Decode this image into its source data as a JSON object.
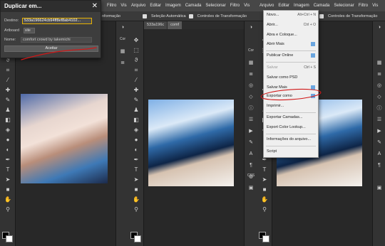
{
  "panel1": {
    "menubar": [
      "Filtro",
      "Vis"
    ],
    "options": [
      "nformação"
    ],
    "dialog": {
      "title": "Duplicar em...",
      "close": "✕",
      "destino_label": "Destino:",
      "destino_value": "533a196624cb94ff8ef8ab4102...",
      "artboard_label": "Artboard",
      "artboard_value": "site",
      "nome_label": "Nome:",
      "nome_value": "comfort crowd by takemichi",
      "accept": "Aceitar"
    }
  },
  "panel2": {
    "menubar": [
      "Arquivo",
      "Editar",
      "Imagem",
      "Camada",
      "Selecionar",
      "Filtro",
      "Vis"
    ],
    "options": [
      "Seleção Automática",
      "Controles de Transformação"
    ],
    "tabs": [
      "533a196c",
      "comf"
    ]
  },
  "panel3": {
    "menubar": [
      "Arquivo",
      "Editar",
      "Imagem",
      "Camada",
      "Selecionar",
      "Filtro",
      "Vis"
    ],
    "options": [
      "Controles de Transformação"
    ],
    "menu": [
      {
        "label": "Novo...",
        "shortcut": "Alt+Ctrl + N"
      },
      {
        "label": "Abrir...",
        "shortcut": "Ctrl + O"
      },
      {
        "label": "Abra e Coloque..."
      },
      {
        "label": "Abrir Mais",
        "submenu": true
      },
      {
        "label": "Publicar Online",
        "submenu": true
      },
      {
        "label": "Salvar",
        "shortcut": "Ctrl + S",
        "disabled": true
      },
      {
        "label": "Salvar como PSD"
      },
      {
        "label": "Salvar Mais",
        "submenu": true
      },
      {
        "label": "Exportar como",
        "submenu": true
      },
      {
        "label": "Imprimir..."
      },
      {
        "label": "Exportar Camadas..."
      },
      {
        "label": "Export Color Lookup..."
      },
      {
        "label": "Informações do arquivo..."
      },
      {
        "label": "Script"
      }
    ]
  },
  "sidebar": {
    "labels": [
      "Cor",
      "Cor",
      "CSS"
    ]
  },
  "colors": {
    "annotation": "#d01818",
    "menubar": "#474747",
    "dialog_border": "#e8b200"
  }
}
